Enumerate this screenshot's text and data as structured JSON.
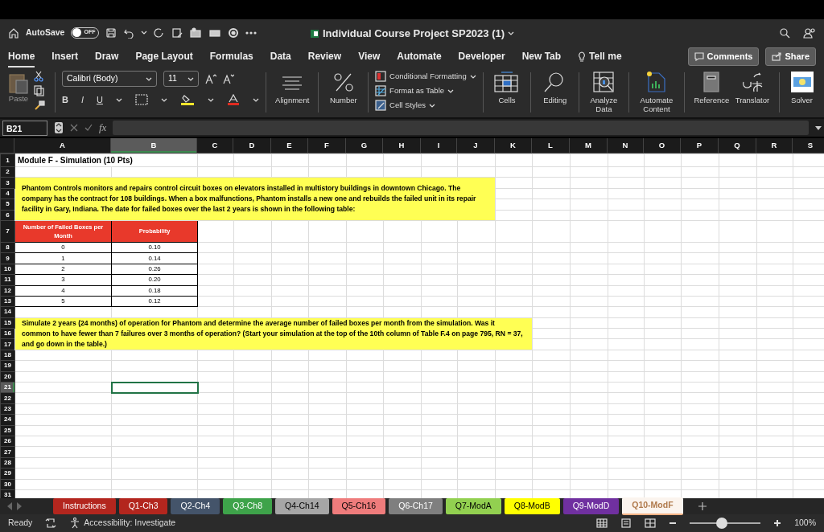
{
  "title_bar": {
    "autosave_label": "AutoSave",
    "autosave": {
      "on": false,
      "label": "OFF"
    },
    "document_title": "Individual Course Project SP2023 (1)"
  },
  "ribbon_tabs": [
    {
      "label": "Home",
      "selected": true
    },
    {
      "label": "Insert",
      "selected": false
    },
    {
      "label": "Draw",
      "selected": false
    },
    {
      "label": "Page Layout",
      "selected": false
    },
    {
      "label": "Formulas",
      "selected": false
    },
    {
      "label": "Data",
      "selected": false
    },
    {
      "label": "Review",
      "selected": false
    },
    {
      "label": "View",
      "selected": false
    },
    {
      "label": "Automate",
      "selected": false
    },
    {
      "label": "Developer",
      "selected": false
    },
    {
      "label": "New Tab",
      "selected": false
    }
  ],
  "tell_me": "Tell me",
  "comments_button": "Comments",
  "share_button": "Share",
  "ribbon": {
    "paste": "Paste",
    "font_name": "Calibri (Body)",
    "font_size": "11",
    "bold": "B",
    "italic": "I",
    "underline": "U",
    "alignment": "Alignment",
    "number": "Number",
    "conditional_formatting": "Conditional Formatting",
    "format_as_table": "Format as Table",
    "cell_styles": "Cell Styles",
    "cells": "Cells",
    "editing": "Editing",
    "analyze_data": "Analyze Data",
    "automate_content": "Automate Content",
    "reference": "Reference",
    "translator": "Translator",
    "solver": "Solver"
  },
  "formula_bar": {
    "name_box": "B21",
    "function_label": "fx"
  },
  "sheet": {
    "columns": [
      {
        "label": "A",
        "selected": false
      },
      {
        "label": "B",
        "selected": true
      },
      {
        "label": "C",
        "selected": false
      },
      {
        "label": "D",
        "selected": false
      },
      {
        "label": "E",
        "selected": false
      },
      {
        "label": "F",
        "selected": false
      },
      {
        "label": "G",
        "selected": false
      },
      {
        "label": "H",
        "selected": false
      },
      {
        "label": "I",
        "selected": false
      },
      {
        "label": "J",
        "selected": false
      },
      {
        "label": "K",
        "selected": false
      },
      {
        "label": "L",
        "selected": false
      },
      {
        "label": "M",
        "selected": false
      },
      {
        "label": "N",
        "selected": false
      },
      {
        "label": "O",
        "selected": false
      },
      {
        "label": "P",
        "selected": false
      },
      {
        "label": "Q",
        "selected": false
      },
      {
        "label": "R",
        "selected": false
      },
      {
        "label": "S",
        "selected": false
      }
    ],
    "rows": [
      {
        "label": "1",
        "selected": false
      },
      {
        "label": "2",
        "selected": false
      },
      {
        "label": "3",
        "selected": false
      },
      {
        "label": "4",
        "selected": false
      },
      {
        "label": "5",
        "selected": false
      },
      {
        "label": "6",
        "selected": false
      },
      {
        "label": "7",
        "selected": false
      },
      {
        "label": "8",
        "selected": false
      },
      {
        "label": "9",
        "selected": false
      },
      {
        "label": "10",
        "selected": false
      },
      {
        "label": "11",
        "selected": false
      },
      {
        "label": "12",
        "selected": false
      },
      {
        "label": "13",
        "selected": false
      },
      {
        "label": "14",
        "selected": false
      },
      {
        "label": "15",
        "selected": false
      },
      {
        "label": "16",
        "selected": false
      },
      {
        "label": "17",
        "selected": false
      },
      {
        "label": "18",
        "selected": false
      },
      {
        "label": "19",
        "selected": false
      },
      {
        "label": "20",
        "selected": false
      },
      {
        "label": "21",
        "selected": true
      },
      {
        "label": "22",
        "selected": false
      },
      {
        "label": "23",
        "selected": false
      },
      {
        "label": "24",
        "selected": false
      },
      {
        "label": "25",
        "selected": false
      },
      {
        "label": "26",
        "selected": false
      },
      {
        "label": "27",
        "selected": false
      },
      {
        "label": "28",
        "selected": false
      },
      {
        "label": "29",
        "selected": false
      },
      {
        "label": "30",
        "selected": false
      },
      {
        "label": "31",
        "selected": false
      }
    ],
    "title": "Module F - Simulation (10 Pts)",
    "intro": "Phantom Controls monitors and repairs control circuit boxes on elevators installed in multistory buildings in downtown Chicago. The company has the contract for 108 buildings. When a box malfunctions, Phantom installs a new one and rebuilds the failed unit in its repair facility in Gary, Indiana. The date for failed boxes over the last 2 years is shown in the following table:",
    "table": {
      "columns": [
        "Number of Failed Boxes per Month",
        "Probability"
      ],
      "rows": [
        [
          "0",
          "0.10"
        ],
        [
          "1",
          "0.14"
        ],
        [
          "2",
          "0.26"
        ],
        [
          "3",
          "0.20"
        ],
        [
          "4",
          "0.18"
        ],
        [
          "5",
          "0.12"
        ]
      ]
    },
    "question": "Simulate 2 years (24 months) of operation for Phantom and determine the average number of failed boxes per month from the simulation. Was it common to have fewer than 7 failures over 3 months of operation? (Start your simulation at the top of the 10th column of Table F.4 on page 795, RN = 37, and go down in the table.)"
  },
  "sheet_tabs": [
    {
      "label": "Instructions",
      "color": "#b3261e",
      "selected": false
    },
    {
      "label": "Q1-Ch3",
      "color": "#b3261e",
      "selected": false
    },
    {
      "label": "Q2-Ch4",
      "color": "#44546a",
      "selected": false
    },
    {
      "label": "Q3-Ch8",
      "color": "#3ea34a",
      "selected": false
    },
    {
      "label": "Q4-Ch14",
      "color": "#a6a6a6",
      "selected": false
    },
    {
      "label": "Q5-Ch16",
      "color": "#ef7c7c",
      "selected": false
    },
    {
      "label": "Q6-Ch17",
      "color": "#7f7f7f",
      "selected": false
    },
    {
      "label": "Q7-ModA",
      "color": "#92d050",
      "selected": false
    },
    {
      "label": "Q8-ModB",
      "color": "#ffff00",
      "selected": false
    },
    {
      "label": "Q9-ModD",
      "color": "#7030a0",
      "selected": false
    },
    {
      "label": "Q10-ModF",
      "color": "#f4b183",
      "selected": true
    }
  ],
  "status_bar": {
    "status": "Ready",
    "accessibility": "Accessibility: Investigate",
    "zoom": {
      "level": 0.45,
      "label": "100%"
    }
  }
}
